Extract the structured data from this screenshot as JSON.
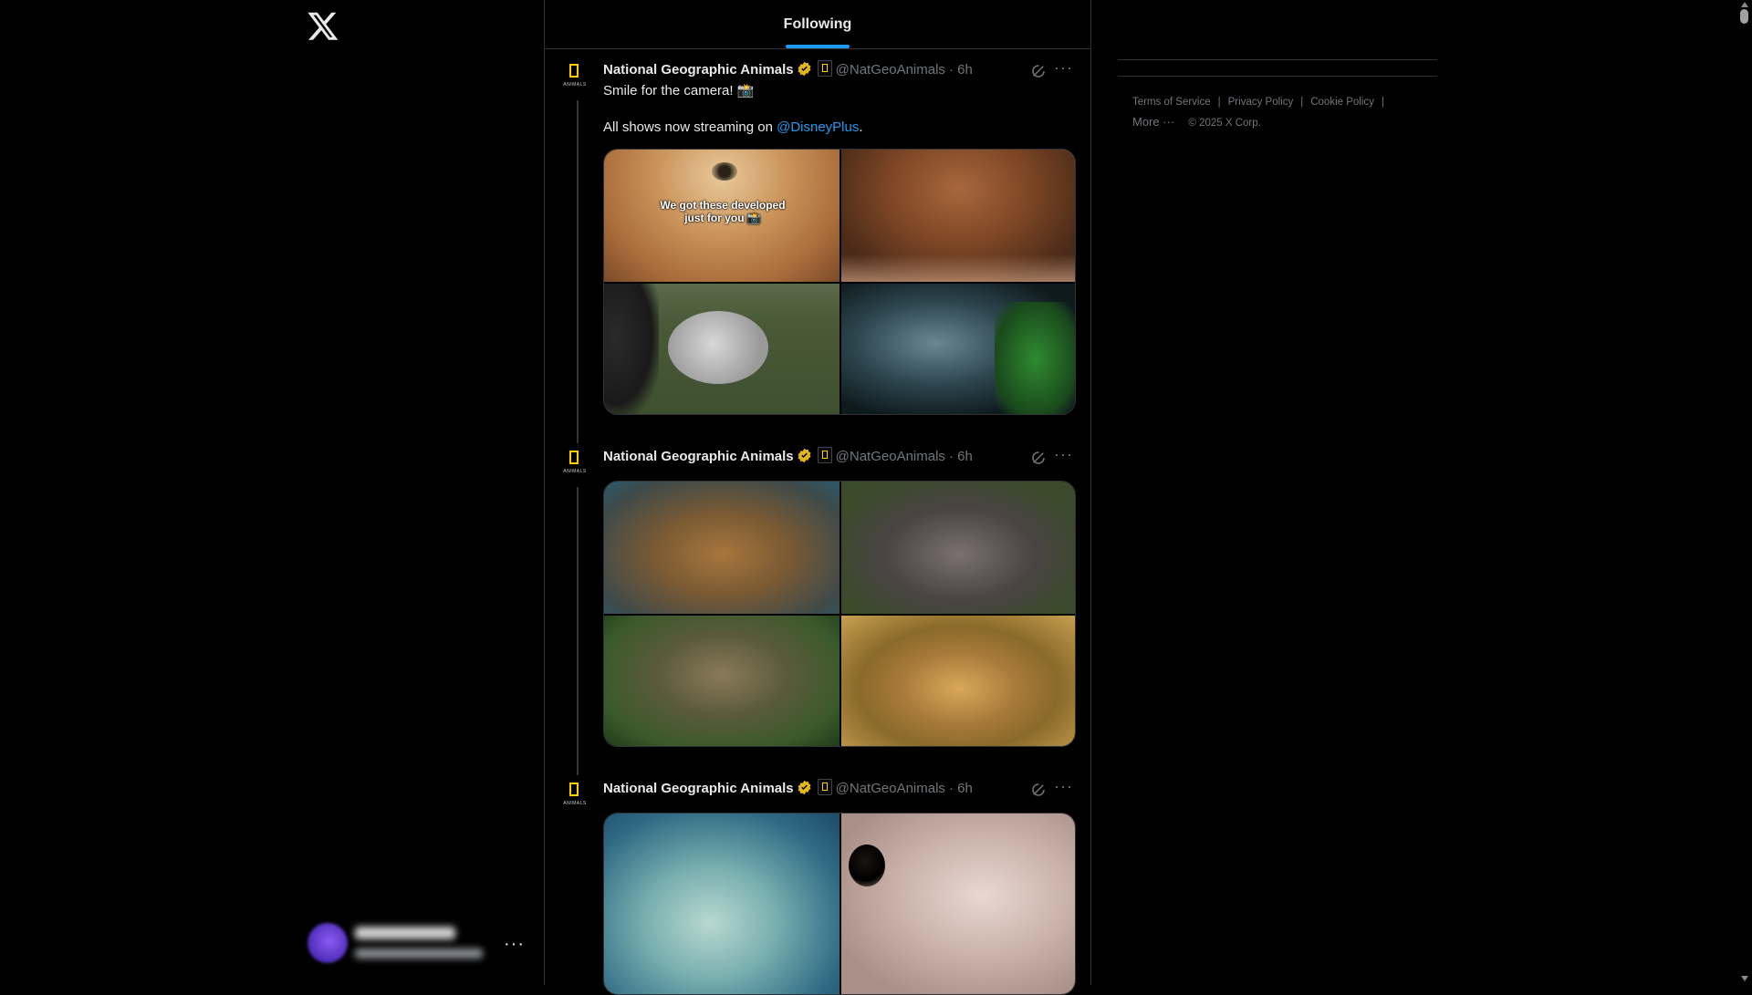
{
  "left_nav": {
    "logo": "x-logo-icon",
    "account_more": "···"
  },
  "timeline": {
    "tab_label": "Following",
    "tab_indicator_color": "#1d9bf0"
  },
  "tweets": [
    {
      "name": "National Geographic Animals",
      "handle": "@NatGeoAnimals",
      "time": "· 6h",
      "avatar_text": "ANIMALS",
      "text_line1": "Smile for the camera! 📸",
      "text_line2_prefix": "All shows now streaming on ",
      "mention": "@DisneyPlus",
      "text_line2_suffix": ".",
      "image_caption": "We got these developed just for you 📸",
      "more": "···"
    },
    {
      "name": "National Geographic Animals",
      "handle": "@NatGeoAnimals",
      "time": "· 6h",
      "avatar_text": "ANIMALS",
      "more": "···"
    },
    {
      "name": "National Geographic Animals",
      "handle": "@NatGeoAnimals",
      "time": "· 6h",
      "avatar_text": "ANIMALS",
      "more": "···"
    }
  ],
  "footer": {
    "terms": "Terms of Service",
    "privacy": "Privacy Policy",
    "cookie": "Cookie Policy",
    "more": "More ···",
    "copyright": "© 2025 X Corp.",
    "separator": "|"
  },
  "colors": {
    "background": "#000000",
    "border": "#2f3336",
    "accent": "#1d9bf0",
    "verified": "#e2b719",
    "muted": "#71767b"
  }
}
